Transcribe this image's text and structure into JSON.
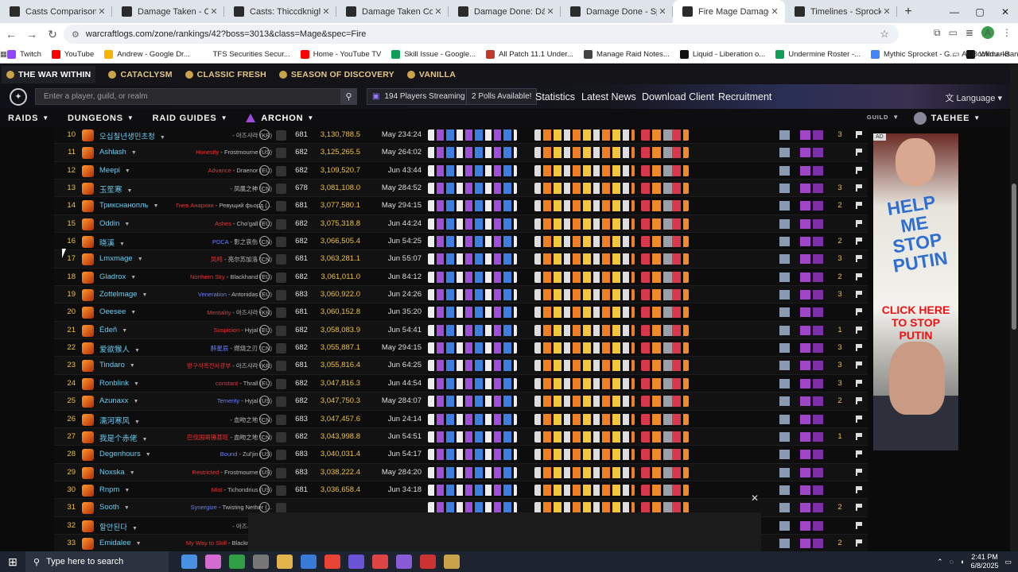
{
  "tabs": [
    {
      "title": "Casts Comparison: Gremb",
      "color": "#2b2b2b"
    },
    {
      "title": "Damage Taken - One-Arm",
      "color": "#2b2b2b"
    },
    {
      "title": "Casts: Thiccdknight - One",
      "color": "#2b2b2b"
    },
    {
      "title": "Damage Taken Comparison",
      "color": "#2b2b2b"
    },
    {
      "title": "Damage Done: Dáymán",
      "color": "#2b2b2b"
    },
    {
      "title": "Damage Done - Sprocket",
      "color": "#2b2b2b"
    },
    {
      "title": "Fire Mage Damage Ranki",
      "color": "#2b2b2b",
      "active": true
    },
    {
      "title": "Timelines - Sprocketmong",
      "color": "#2b2b2b"
    }
  ],
  "address": {
    "url": "warcraftlogs.com/zone/rankings/42?boss=3013&class=Mage&spec=Fire"
  },
  "bookmarks": [
    {
      "label": "Twitch",
      "color": "#9146ff"
    },
    {
      "label": "YouTube",
      "color": "#ff0000"
    },
    {
      "label": "Andrew - Google Dr...",
      "color": "#f4b400"
    },
    {
      "label": "TFS Securities Secur...",
      "color": "#ffffff"
    },
    {
      "label": "Home - YouTube TV",
      "color": "#ff0000"
    },
    {
      "label": "Skill Issue - Google...",
      "color": "#0f9d58"
    },
    {
      "label": "All Patch 11.1 Under...",
      "color": "#c0392b"
    },
    {
      "label": "Manage Raid Notes...",
      "color": "#444444"
    },
    {
      "label": "Liquid - Liberation o...",
      "color": "#111111"
    },
    {
      "label": "Undermine Roster -...",
      "color": "#0f9d58"
    },
    {
      "label": "Mythic Sprocket - G...",
      "color": "#4285f4"
    },
    {
      "label": "Wildu - Bandit Bars...",
      "color": "#111111"
    }
  ],
  "all_bookmarks": "All Bookmarks",
  "game_tabs": [
    "THE WAR WITHIN",
    "CATACLYSM",
    "CLASSIC FRESH",
    "SEASON OF DISCOVERY",
    "VANILLA"
  ],
  "header": {
    "search_placeholder": "Enter a player, guild, or realm",
    "streaming": "194 Players Streaming",
    "polls": "2 Polls Available!",
    "links": [
      "Statistics",
      "Latest News",
      "Download Client",
      "Recruitment"
    ],
    "language": "Language"
  },
  "nav": {
    "items": [
      "RAIDS",
      "DUNGEONS",
      "RAID GUIDES",
      "ARCHON"
    ],
    "guild": "GUILD",
    "user": "TAEHEE"
  },
  "rows": [
    {
      "rank": "10",
      "name": "오십칠년생민초청",
      "guild": "",
      "realm": "아즈샤라 (KR)",
      "ilvl": "681",
      "dps": "3,130,788.5",
      "date": "May 23",
      "dur": "4:24",
      "count": "3"
    },
    {
      "rank": "11",
      "name": "Ashlash",
      "guild": "Honestly",
      "realm": "Frostmourne (US)",
      "ilvl": "682",
      "dps": "3,125,265.5",
      "date": "May 26",
      "dur": "4:02",
      "count": ""
    },
    {
      "rank": "12",
      "name": "Meepi",
      "guild": "Advance",
      "realm": "Draenor (EU)",
      "ilvl": "682",
      "dps": "3,109,520.7",
      "date": "Jun 4",
      "dur": "3:44",
      "count": ""
    },
    {
      "rank": "13",
      "name": "玉笙寒",
      "guild": "",
      "realm": "凤凰之神 (CN)",
      "ilvl": "678",
      "dps": "3,081,108.0",
      "date": "May 28",
      "dur": "4:52",
      "count": "3"
    },
    {
      "rank": "14",
      "name": "Трикснанопль",
      "guild": "Гнев Анархии",
      "realm": "Ревущий фьорд (...",
      "ilvl": "681",
      "dps": "3,077,580.1",
      "date": "May 29",
      "dur": "4:15",
      "count": "2"
    },
    {
      "rank": "15",
      "name": "Oddin",
      "guild": "Ashes",
      "realm": "Cho'gall (EU)",
      "ilvl": "682",
      "dps": "3,075,318.8",
      "date": "Jun 4",
      "dur": "4:24",
      "count": ""
    },
    {
      "rank": "16",
      "name": "晓溪",
      "guild": "PDCA",
      "realm": "影之哀伤 (CN)",
      "ilvl": "682",
      "dps": "3,066,505.4",
      "date": "Jun 5",
      "dur": "4:25",
      "count": "2"
    },
    {
      "rank": "17",
      "name": "Lmxmage",
      "guild": "凤鸣",
      "realm": "亮尔苏加洛 (CN)",
      "ilvl": "681",
      "dps": "3,063,281.1",
      "date": "Jun 5",
      "dur": "5:07",
      "count": "3"
    },
    {
      "rank": "18",
      "name": "Gladrox",
      "guild": "Northern Sky",
      "realm": "Blackhand (EU)",
      "ilvl": "682",
      "dps": "3,061,011.0",
      "date": "Jun 8",
      "dur": "4:12",
      "count": "2"
    },
    {
      "rank": "19",
      "name": "Zottelmage",
      "guild": "Veneration",
      "realm": "Antonidas (EU)",
      "ilvl": "683",
      "dps": "3,060,922.0",
      "date": "Jun 2",
      "dur": "4:26",
      "count": "3"
    },
    {
      "rank": "20",
      "name": "Oeesee",
      "guild": "Mentality",
      "realm": "아즈샤라 (KR)",
      "ilvl": "681",
      "dps": "3,060,152.8",
      "date": "Jun 3",
      "dur": "5:20",
      "count": ""
    },
    {
      "rank": "21",
      "name": "Édeñ",
      "guild": "Suspicion",
      "realm": "Hyjal (EU)",
      "ilvl": "682",
      "dps": "3,058,083.9",
      "date": "Jun 5",
      "dur": "4:41",
      "count": "1"
    },
    {
      "rank": "22",
      "name": "爱欲猴人",
      "guild": "醉星辰",
      "realm": "燃烧之刃 (CN)",
      "ilvl": "682",
      "dps": "3,055,887.1",
      "date": "May 29",
      "dur": "4:15",
      "count": "3"
    },
    {
      "rank": "23",
      "name": "Tindaro",
      "guild": "방구석흑전사광부",
      "realm": "아즈샤라 (KR)",
      "ilvl": "681",
      "dps": "3,055,816.4",
      "date": "Jun 6",
      "dur": "4:25",
      "count": "3"
    },
    {
      "rank": "24",
      "name": "Ronblink",
      "guild": "constant",
      "realm": "Thrall (EU)",
      "ilvl": "682",
      "dps": "3,047,816.3",
      "date": "Jun 4",
      "dur": "4:54",
      "count": "3"
    },
    {
      "rank": "25",
      "name": "Azunaxx",
      "guild": "Temerity",
      "realm": "Hyjal (US)",
      "ilvl": "682",
      "dps": "3,047,750.3",
      "date": "May 28",
      "dur": "4:07",
      "count": "2"
    },
    {
      "rank": "26",
      "name": "濡河寒风",
      "guild": "",
      "realm": "血吻之地 (CN)",
      "ilvl": "683",
      "dps": "3,047,457.6",
      "date": "Jun 2",
      "dur": "4:14",
      "count": ""
    },
    {
      "rank": "27",
      "name": "我是个赤佬",
      "guild": "巴伐国哥锤甚旺",
      "realm": "血吻之地 (CN)",
      "ilvl": "682",
      "dps": "3,043,998.8",
      "date": "Jun 5",
      "dur": "4:51",
      "count": "1"
    },
    {
      "rank": "28",
      "name": "Degenhours",
      "guild": "Bound",
      "realm": "Zul'jin (US)",
      "ilvl": "683",
      "dps": "3,040,031.4",
      "date": "Jun 5",
      "dur": "4:17",
      "count": ""
    },
    {
      "rank": "29",
      "name": "Noxska",
      "guild": "Restricted",
      "realm": "Frostmourne (US)",
      "ilvl": "683",
      "dps": "3,038,222.4",
      "date": "May 28",
      "dur": "4:20",
      "count": ""
    },
    {
      "rank": "30",
      "name": "Rnpm",
      "guild": "Mist",
      "realm": "Tichondrius (US)",
      "ilvl": "681",
      "dps": "3,036,658.4",
      "date": "Jun 3",
      "dur": "4:18",
      "count": ""
    },
    {
      "rank": "31",
      "name": "Sooth",
      "guild": "Synergize",
      "realm": "Twisting Nether (...",
      "ilvl": "",
      "dps": "",
      "date": "",
      "dur": "",
      "count": "2"
    },
    {
      "rank": "32",
      "name": "할안된다",
      "guild": "",
      "realm": "아즈샤라 (KR)",
      "ilvl": "",
      "dps": "",
      "date": "",
      "dur": "",
      "count": ""
    },
    {
      "rank": "33",
      "name": "Emidalee",
      "guild": "My Way to Skill",
      "realm": "Blackmoore (...",
      "ilvl": "",
      "dps": "",
      "date": "",
      "dur": "",
      "count": "2"
    }
  ],
  "ad": {
    "badge": "AD",
    "line1": "HELP ME STOP PUTIN",
    "line2": "CLICK HERE TO STOP PUTIN"
  },
  "taskbar": {
    "search_placeholder": "Type here to search",
    "time": "2:41 PM",
    "date": "6/8/2025"
  }
}
